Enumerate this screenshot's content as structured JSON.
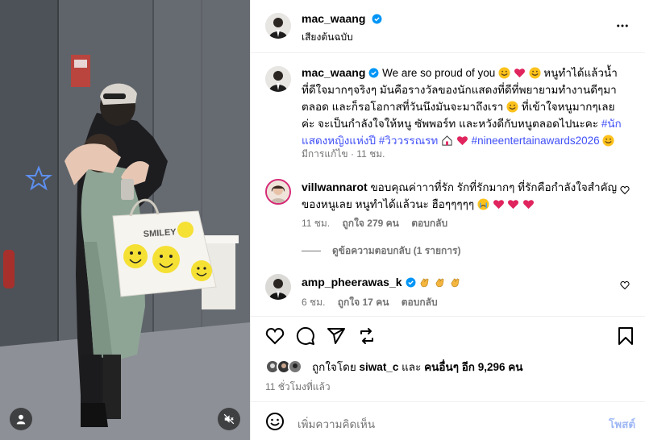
{
  "post": {
    "author": "mac_waang",
    "audio_label": "เสียงต้นฉบับ",
    "caption": {
      "username": "mac_waang",
      "text_1": "We are so proud of you",
      "text_2": "หนูทำได้แล้วน้ำ ที่ดีใจมากๆจริงๆ มันคือรางวัลของนักแสดงที่ดีที่พยายามทำงานดีๆมาตลอด และก็รอโอกาสที่วันนึงมันจะมาถึงเรา",
      "text_3": "ที่เข้าใจหนูมากๆเลยค่ะ จะเป็นกำลังใจให้หนู ซัพพอร์ท และหวังดีกับหนูตลอดไปนะคะ",
      "hashtag_1": "#นักแสดงหญิงแห่งปี",
      "hashtag_2": "#วิววรรณรท",
      "hashtag_3": "#nineentertainawards2026",
      "edited": "มีการแก้ไข",
      "time": "11 ชม."
    }
  },
  "comments": [
    {
      "username": "villwannarot",
      "text": "ขอบคุณค่าาาที่รัก รักที่รักมากๆ ที่รักคือกำลังใจสำคัญของหนูเลย หนูทำได้แล้วนะ ฮือๆๆๆๆๆ",
      "time": "11 ชม.",
      "likes": "ถูกใจ 279 คน",
      "reply": "ตอบกลับ",
      "view_replies": "ดูข้อความตอบกลับ (1 รายการ)"
    },
    {
      "username": "amp_pheerawas_k",
      "text": "",
      "time": "6 ชม.",
      "likes": "ถูกใจ 17 คน",
      "reply": "ตอบกลับ"
    }
  ],
  "likes_summary": {
    "prefix": "ถูกใจโดย",
    "user": "siwat_c",
    "and": "และ",
    "others": "คนอื่นๆ อีก 9,296 คน"
  },
  "posted_ago": "11 ชั่วโมงที่แล้ว",
  "add_comment": {
    "placeholder": "เพิ่มความคิดเห็น",
    "post_button": "โพสต์"
  },
  "media": {
    "bag_text": "SMILEY"
  },
  "icons": [
    "more-icon",
    "heart-icon",
    "comment-icon",
    "share-icon",
    "save-icon",
    "emoji-icon",
    "user-tag-icon",
    "mute-icon",
    "verified-icon"
  ],
  "colors": {
    "link": "#4150f7",
    "verified": "#0095f6",
    "meta": "#737373",
    "post_disabled": "#9fb8f5"
  }
}
